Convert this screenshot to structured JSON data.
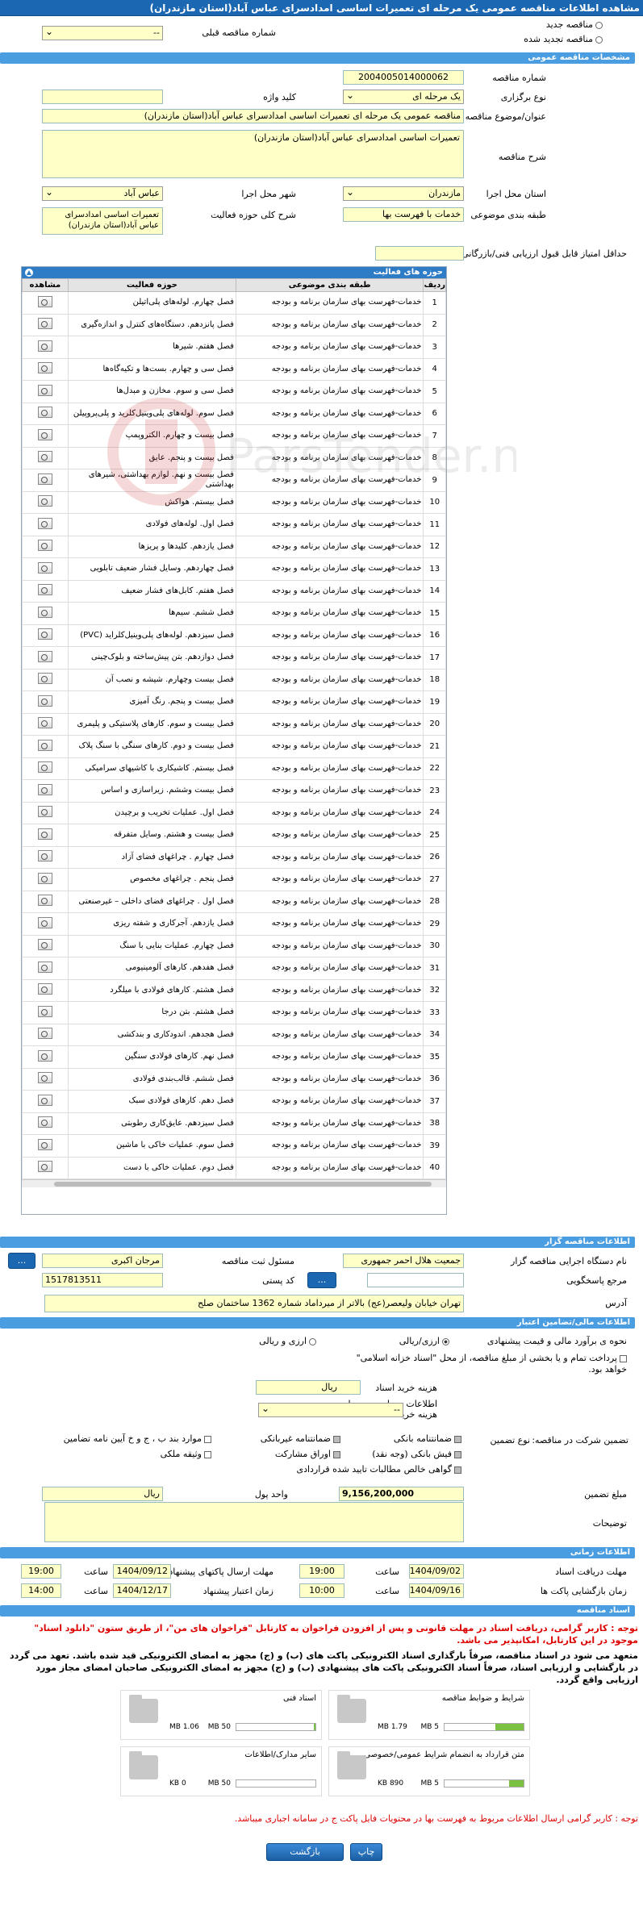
{
  "title": "مشاهده اطلاعات مناقصه عمومی یک مرحله ای تعمیرات اساسی امدادسرای عباس آباد(استان مازندران)",
  "top": {
    "new": "مناقصه جدید",
    "renewed": "مناقصه تجدید شده",
    "prev_label": "شماره مناقصه قبلی",
    "prev_value": "--"
  },
  "general": {
    "head": "مشخصات مناقصه عمومی",
    "number_label": "شماره مناقصه",
    "number": "2004005014000062",
    "type_label": "نوع برگزاری",
    "type": "یک مرحله ای",
    "keyword_label": "کلید واژه",
    "keyword": "",
    "subject_label": "عنوان/موضوع مناقصه",
    "subject": "مناقصه عمومی یک مرحله ای تعمیرات اساسی امدادسرای عباس آباد(استان مازندران)",
    "desc_label": "شرح مناقصه",
    "desc": "تعمیرات اساسی امدادسرای عباس آباد(استان مازندران)",
    "province_label": "استان محل اجرا",
    "province": "مازندران",
    "city_label": "شهر محل اجرا",
    "city": "عباس آباد",
    "cat_label": "طبقه بندی موضوعی",
    "cat": "خدمات با فهرست بها",
    "scope_label": "شرح کلی حوزه فعالیت",
    "scope": "تعمیرات اساسی امدادسرای عباس آباد(استان مازندران)",
    "min_score_label": "حداقل امتیاز قابل قبول ارزیابی فنی/بازرگانی",
    "min_score": ""
  },
  "activities": {
    "head": "حوزه های فعالیت",
    "cols": {
      "row": "ردیف",
      "cat": "طبقه بندی موضوعی",
      "area": "حوزه فعالیت",
      "view": "مشاهده"
    },
    "cat_text": "خدمات-فهرست بهای سازمان برنامه و بودجه",
    "items": [
      "فصل چهارم. لوله‌های پلی‌اتیلن",
      "فصل پانزدهم. دستگاه‌های کنترل و اندازه‌گیری",
      "فصل هفتم. شیرها",
      "فصل سی و چهارم. بست‌ها و تکیه‌گاه‌ها",
      "فصل سی و سوم. مخازن و مبدل‌ها",
      "فصل سوم. لوله‌های پلی‌وینیل‌کلرید و پلی‌پروپیلن",
      "فصل بیست و چهارم. الکتروپمپ",
      "فصل بیست و پنجم. عایق",
      "فصل بیست و نهم. لوازم بهداشتی، شیرهای بهداشتی",
      "فصل بیستم. هواکش",
      "فصل اول. لوله‌های فولادی",
      "فصل یازدهم. کلیدها و پریزها",
      "فصل چهاردهم. وسایل فشار ضعیف تابلویی",
      "فصل هفتم. کابل‌های فشار ضعیف",
      "فصل ششم. سیم‌ها",
      "فصل سیزدهم. لوله‌های پلی‌وینیل‌کلراید (PVC)",
      "فصل دوازدهم. بتن پیش‌ساخته و بلوک‌چینی",
      "فصل بیست وچهارم. شیشه و نصب آن",
      "فصل بیست و پنجم. رنگ آمیزی",
      "فصل بیست و سوم. کارهای پلاستیکی و پلیمری",
      "فصل بیست و دوم. کارهای سنگی با سنگ پلاک",
      "فصل بیستم. کاشیکاری با کاشیهای سرامیکی",
      "فصل بیست وششم. زیراسازی و اساس",
      "فصل اول. عملیات تخریب و برچیدن",
      "فصل بیست و هشتم. وسایل متفرقه",
      "فصل چهارم . چراغهای فضای آزاد",
      "فصل پنجم . چراغهای مخصوص",
      "فصل اول . چراغهای فضای داخلی – غیرصنعتی",
      "فصل یازدهم. آجرکاری و شفته ریزی",
      "فصل چهارم. عملیات بنایی با سنگ",
      "فصل هفدهم. کارهای آلومینیومی",
      "فصل هشتم. کارهای فولادی با میلگرد",
      "فصل هشتم. بتن درجا",
      "فصل هجدهم. اندودکاری و بندکشی",
      "فصل نهم. کارهای فولادی سنگین",
      "فصل ششم. قالب‌بندی فولادی",
      "فصل دهم. کارهای فولادی سبک",
      "فصل سیزدهم. عایق‌کاری رطوبتی",
      "فصل سوم. عملیات خاکی با ماشین",
      "فصل دوم. عملیات خاکی با دست"
    ]
  },
  "organizer": {
    "head": "اطلاعات مناقصه گزار",
    "org_label": "نام دستگاه اجرایی مناقصه گزار",
    "org": "جمعیت هلال احمر جمهوری",
    "resp_label": "مسئول ثبت مناقصه",
    "resp": "مرجان اکبری",
    "ref_label": "مرجع پاسخگویی",
    "ref": "",
    "postal_label": "کد پستی",
    "postal": "1517813511",
    "addr_label": "آدرس",
    "addr": "تهران خیابان ولیعصر(عج) بالاتر از میرداماد شماره 1362 ساختمان صلح",
    "btn_more": "...",
    "btn_dots": "..."
  },
  "finance": {
    "head": "اطلاعات مالی/تضامین اعتبار",
    "estimate_label": "نحوه ی برآورد مالی و قیمت پیشنهادی",
    "opt1": "ارزی/ریالی",
    "opt2": "ارزی و ریالی",
    "treasury": "پرداخت تمام و یا بخشی از مبلغ مناقصه، از محل \"اسناد خزانه اسلامی\" خواهد بود.",
    "doc_price_label": "هزینه خرید اسناد",
    "doc_price_unit": "ریال",
    "account_label": "اطلاعات حساب جهت واریز هزینه خرید اسناد",
    "account": "--",
    "guar_type_label": "نوع تضمین",
    "guar_company_label": "تضمین شرکت در مناقصه:",
    "g1": "ضمانتنامه بانکی",
    "g2": "ضمانتنامه غیربانکی",
    "g3": "موارد بند ب ، ج و خ آیین نامه تضامین",
    "g4": "فیش بانکی (وجه نقد)",
    "g5": "اوراق مشارکت",
    "g6": "وثیقه ملکی",
    "g7": "گواهی خالص مطالبات تایید شده قراردادی",
    "amount_label": "مبلغ تضمین",
    "amount": "9,156,200,000",
    "unit_label": "واحد پول",
    "unit": "ریال",
    "notes_label": "توضیحات"
  },
  "timing": {
    "head": "اطلاعات زمانی",
    "recv_label": "مهلت دریافت اسناد",
    "recv_date": "1404/09/02",
    "recv_time": "19:00",
    "send_label": "مهلت ارسال پاکتهای پیشنهاد",
    "send_date": "1404/09/12",
    "send_time": "19:00",
    "open_label": "زمان بازگشایی پاکت ها",
    "open_date": "1404/09/16",
    "open_time": "10:00",
    "valid_label": "زمان اعتبار پیشنهاد",
    "valid_date": "1404/12/17",
    "valid_time": "14:00",
    "time_label": "ساعت"
  },
  "docs": {
    "head": "اسناد مناقصه",
    "note1": "توجه : کاربر گرامی، دریافت اسناد در مهلت قانونی و پس از افزودن فراخوان به کارتابل \"فراخوان های من\"، از طریق ستون \"دانلود اسناد\" موجود در این کارتابل، امکانپذیر می باشد.",
    "note2": "متعهد می شود در اسناد مناقصه، صرفاً بارگذاری اسناد الکترونیکی پاکت های (ب) و (ج) مجهز به امضای الکترونیکی قید شده باشد. تعهد می گردد در بارگشایی و ارزیابی اسناد، صرفاً اسناد الکترونیکی پاکت های پیشنهادی (ب) و (ج) مجهز به امضای الکترونیکی صاحبان امضای مجاز مورد ارزیابی واقع گردد.",
    "files": [
      {
        "name": "شرایط و ضوابط مناقصه",
        "max": "5 MB",
        "cur": "1.79 MB",
        "pct": 36
      },
      {
        "name": "اسناد فنی",
        "max": "50 MB",
        "cur": "1.06 MB",
        "pct": 2
      },
      {
        "name": "متن قرارداد به انضمام شرایط عمومی/خصوصی",
        "max": "5 MB",
        "cur": "890 KB",
        "pct": 18
      },
      {
        "name": "سایر مدارک/اطلاعات",
        "max": "50 MB",
        "cur": "0 KB",
        "pct": 0
      }
    ],
    "note3": "توجه : کاربر گرامی ارسال اطلاعات مربوط به فهرست بها در محتویات فایل پاکت ج در سامانه اجباری میباشد."
  },
  "actions": {
    "back": "بازگشت",
    "print": "چاپ"
  },
  "watermark": "ParsTender.net"
}
